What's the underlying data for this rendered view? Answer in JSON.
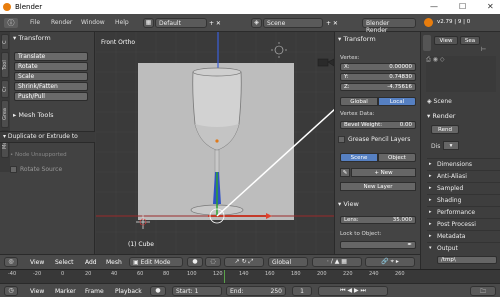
{
  "window": {
    "title": "Blender",
    "minimize": "—",
    "maximize": "☐",
    "close": "✕"
  },
  "menubar": {
    "items": [
      "File",
      "Render",
      "Window",
      "Help"
    ],
    "layout": "Default",
    "scene": "Scene",
    "engine": "Blender Render",
    "version": "v2.79 | 9 | 0"
  },
  "left_tool": {
    "tabs": [
      "C",
      "Tool",
      "Cr",
      "Grea",
      "Mea"
    ],
    "transform_header": "Transform",
    "transform_buttons": [
      "Translate",
      "Rotate",
      "Scale",
      "Shrink/Fatten",
      "Push/Pull"
    ],
    "mesh_tools_header": "Mesh Tools",
    "duplicate_header": "Duplicate or Extrude to",
    "node_unsupported": "Node Unsupported",
    "rotate_source": "Rotate Source"
  },
  "viewport": {
    "view_label": "Front Ortho",
    "object_label": "(1) Cube"
  },
  "n_panel": {
    "transform_header": "Transform",
    "vertex_label": "Vertex:",
    "x": {
      "label": "X:",
      "value": "0.00000"
    },
    "y": {
      "label": "Y:",
      "value": "0.74830"
    },
    "z": {
      "label": "Z:",
      "value": "-4.75616"
    },
    "global": "Global",
    "local": "Local",
    "vertex_data": "Vertex Data:",
    "bevel_weight": {
      "label": "Bevel Weight:",
      "value": "0.00"
    },
    "grease_header": "Grease Pencil Layers",
    "scene_tab": "Scene",
    "object_tab": "Object",
    "new_button": "New",
    "new_layer_button": "New Layer",
    "view_header": "View",
    "lens": {
      "label": "Lens:",
      "value": "35.000"
    },
    "lock_label": "Lock to Object:"
  },
  "right_props": {
    "view_tab": "View",
    "search_tab": "Sea",
    "scene_label": "Scene",
    "render_header": "Render",
    "render_btn": "Rend",
    "display_label": "Dis",
    "sections": [
      "Dimensions",
      "Anti-Aliasi",
      "Sampled",
      "Shading",
      "Performance",
      "Post Processi",
      "Metadata",
      "Output"
    ],
    "output_path": "/tmp\\"
  },
  "viewport_header": {
    "items": [
      "View",
      "Select",
      "Add",
      "Mesh"
    ],
    "mode": "Edit Mode",
    "orientation": "Global"
  },
  "timeline": {
    "ticks": [
      "-40",
      "-20",
      "0",
      "20",
      "40",
      "60",
      "80",
      "100",
      "120",
      "140",
      "160",
      "180",
      "200",
      "220",
      "240",
      "260"
    ],
    "menu": [
      "View",
      "Marker",
      "Frame",
      "Playback"
    ],
    "start": {
      "label": "Start:",
      "value": "1"
    },
    "end": {
      "label": "End:",
      "value": "250"
    },
    "current": "1"
  }
}
